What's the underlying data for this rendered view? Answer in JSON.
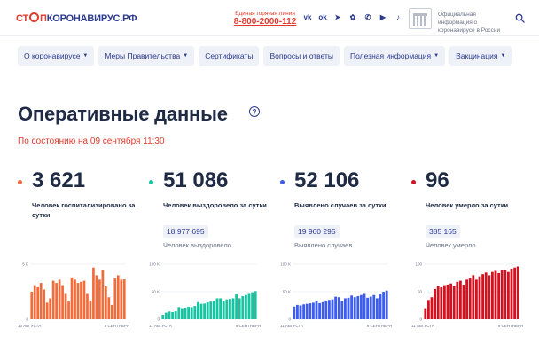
{
  "header": {
    "logo": {
      "part1": "СТ",
      "part2": "П",
      "part3": "КОРОНАВИРУС.РФ"
    },
    "hotline_label": "Единая горячая линия",
    "hotline_number": "8-800-2000-112",
    "socials": [
      {
        "icon": "vk-icon",
        "glyph": "vk"
      },
      {
        "icon": "ok-icon",
        "glyph": "ok"
      },
      {
        "icon": "telegram-icon",
        "glyph": "➤"
      },
      {
        "icon": "odnoklassniki-icon",
        "glyph": "✿"
      },
      {
        "icon": "viber-icon",
        "glyph": "✆"
      },
      {
        "icon": "youtube-icon",
        "glyph": "▶"
      },
      {
        "icon": "tiktok-icon",
        "glyph": "♪"
      }
    ],
    "gov_text": "Официальная информация о коронавирусе в России"
  },
  "nav": [
    {
      "label": "О коронавирусе",
      "dropdown": true
    },
    {
      "label": "Меры Правительства",
      "dropdown": true
    },
    {
      "label": "Сертификаты",
      "dropdown": false
    },
    {
      "label": "Вопросы и ответы",
      "dropdown": false
    },
    {
      "label": "Полезная информация",
      "dropdown": true
    },
    {
      "label": "Вакцинация",
      "dropdown": true
    }
  ],
  "main": {
    "title": "Оперативные данные",
    "help_glyph": "?",
    "subtitle": "По состоянию на 09 сентября 11:30"
  },
  "stats": [
    {
      "value": "3 621",
      "label": "Человек госпитализировано за сутки",
      "total": "",
      "total_label": "",
      "color": "#f26b3a"
    },
    {
      "value": "51 086",
      "label": "Человек выздоровело за сутки",
      "total": "18 977 695",
      "total_label": "Человек выздоровело",
      "color": "#17c3a0"
    },
    {
      "value": "52 106",
      "label": "Выявлено случаев за сутки",
      "total": "19 960 295",
      "total_label": "Выявлено случаев",
      "color": "#3d5cf0"
    },
    {
      "value": "96",
      "label": "Человек умерло за сутки",
      "total": "385 165",
      "total_label": "Человек умерло",
      "color": "#d4121f"
    }
  ],
  "chart_data": [
    {
      "type": "bar",
      "color": "#f26b3a",
      "y_ticks": [
        "5 K",
        "0"
      ],
      "ylim": [
        0,
        5000
      ],
      "x_start": "10 АВГУСТА",
      "x_end": "9 СЕНТЯБРЯ",
      "values": [
        2500,
        3100,
        2900,
        3300,
        2700,
        1500,
        1900,
        3500,
        3300,
        3600,
        3100,
        2300,
        1600,
        3800,
        3600,
        3300,
        3400,
        3500,
        2300,
        1700,
        4700,
        4000,
        3600,
        4500,
        3000,
        2000,
        1300,
        3700,
        4000,
        3600,
        3621
      ]
    },
    {
      "type": "bar",
      "color": "#17c3a0",
      "y_ticks": [
        "100 K",
        "50 K",
        "0"
      ],
      "ylim": [
        0,
        100000
      ],
      "x_start": "11 АВГУСТА",
      "x_end": "9 СЕНТЯБРЯ",
      "values": [
        8000,
        12000,
        14000,
        13000,
        14500,
        22000,
        20000,
        21000,
        22500,
        22000,
        24000,
        31000,
        28000,
        28500,
        30500,
        32000,
        33000,
        38000,
        38000,
        33000,
        36000,
        37000,
        38000,
        45000,
        38000,
        42000,
        44000,
        46000,
        49000,
        51086
      ]
    },
    {
      "type": "bar",
      "color": "#3d5cf0",
      "y_ticks": [
        "100 K",
        "50 K",
        "0"
      ],
      "ylim": [
        0,
        100000
      ],
      "x_start": "11 АВГУСТА",
      "x_end": "9 СЕНТЯБРЯ",
      "values": [
        23000,
        26000,
        25000,
        27000,
        28000,
        29000,
        30000,
        33000,
        29000,
        31000,
        34000,
        35000,
        36000,
        41000,
        40000,
        33000,
        38000,
        39000,
        43000,
        40000,
        42000,
        44000,
        46000,
        39000,
        41000,
        44000,
        38000,
        45000,
        50000,
        52106
      ]
    },
    {
      "type": "bar",
      "color": "#d4121f",
      "y_ticks": [
        "100",
        "50",
        "0"
      ],
      "ylim": [
        0,
        100
      ],
      "x_start": "11 АВГУСТА",
      "x_end": "9 СЕНТЯБРЯ",
      "values": [
        20,
        35,
        40,
        55,
        60,
        58,
        62,
        63,
        65,
        60,
        68,
        70,
        63,
        72,
        74,
        80,
        72,
        78,
        82,
        85,
        80,
        86,
        88,
        84,
        89,
        90,
        86,
        92,
        94,
        96
      ]
    }
  ]
}
